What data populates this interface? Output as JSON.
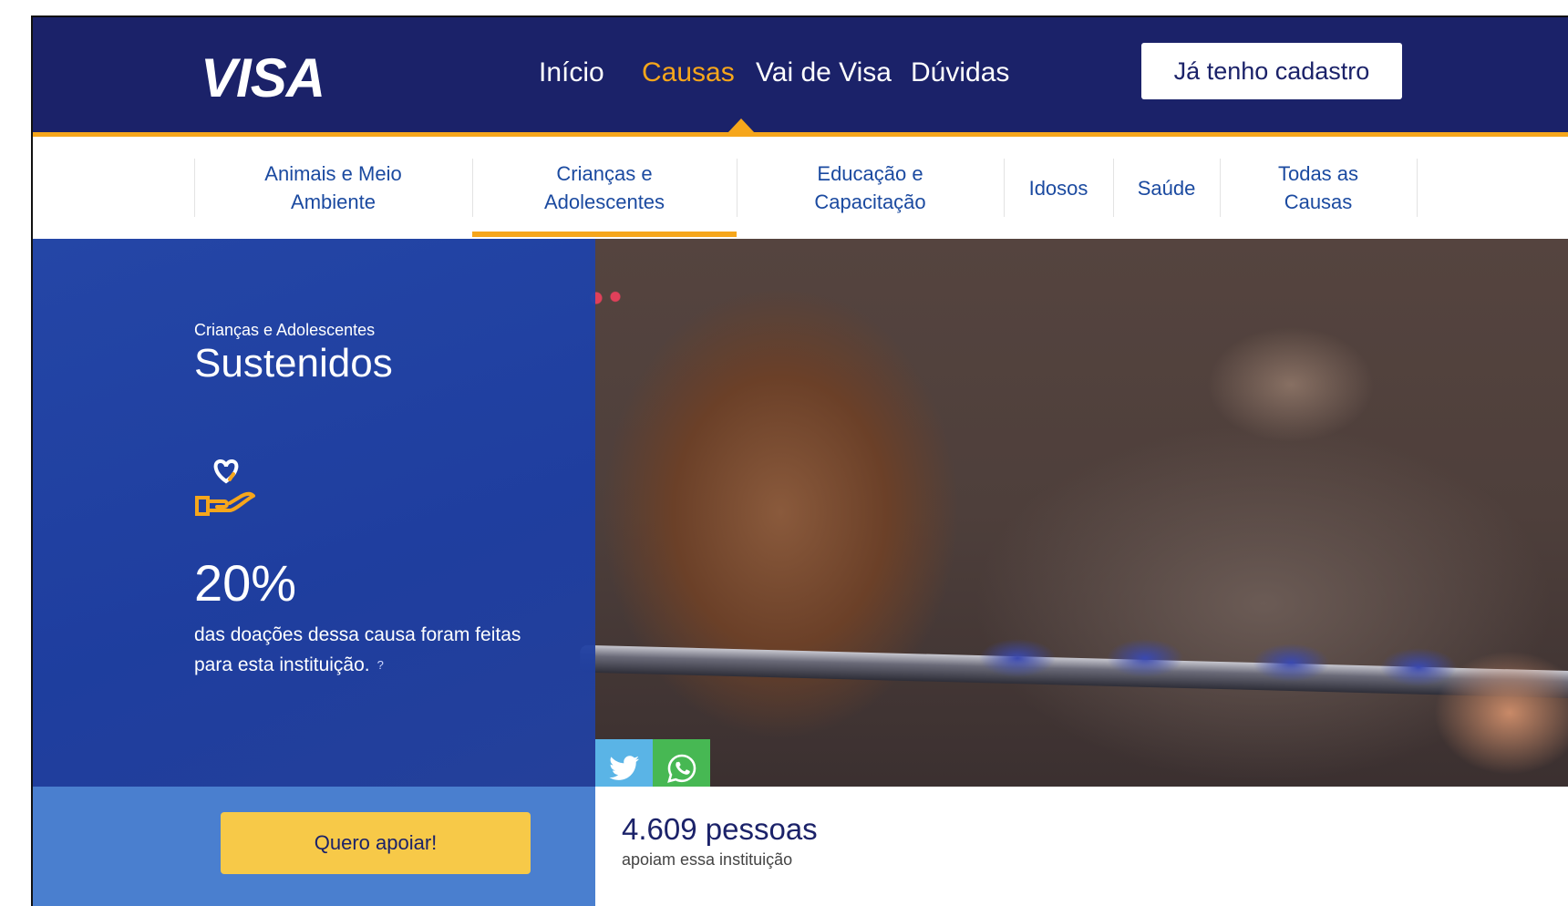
{
  "header": {
    "logo": "VISA",
    "nav": [
      "Início",
      "Causas",
      "Vai de Visa",
      "Dúvidas"
    ],
    "active_nav": "Causas",
    "login_button": "Já tenho cadastro"
  },
  "subnav": {
    "items": [
      {
        "line1": "Animais e Meio",
        "line2": "Ambiente"
      },
      {
        "line1": "Crianças e",
        "line2": "Adolescentes"
      },
      {
        "line1": "Educação e",
        "line2": "Capacitação"
      },
      {
        "line1": "Idosos",
        "line2": ""
      },
      {
        "line1": "Saúde",
        "line2": ""
      },
      {
        "line1": "Todas as",
        "line2": "Causas"
      }
    ],
    "active": "Crianças e Adolescentes"
  },
  "hero": {
    "category": "Crianças e Adolescentes",
    "title": "Sustenidos",
    "icon": "hand-heart-icon",
    "percent": "20%",
    "description": "das doações dessa causa foram feitas para esta instituição.",
    "help": "?",
    "share": [
      "twitter-icon",
      "whatsapp-icon"
    ]
  },
  "support": {
    "button": "Quero apoiar!",
    "count": "4.609",
    "count_unit": "pessoas",
    "count_label": "apoiam essa instituição"
  },
  "colors": {
    "navy": "#1b2269",
    "accent": "#f6a61b",
    "blue_panel": "#4a7fcf",
    "button_yellow": "#f7c948",
    "link_blue": "#1b4aa0"
  }
}
